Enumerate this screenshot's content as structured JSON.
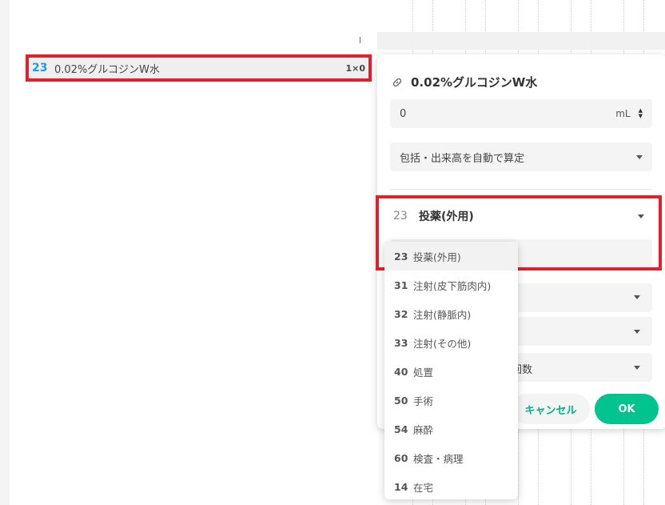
{
  "order_row": {
    "code": "23",
    "name": "0.02%グルコジンW水",
    "qty": "1×0"
  },
  "corner_mark": "l",
  "panel": {
    "title": "0.02%グルコジンW水",
    "amount_value": "0",
    "amount_unit": "mL",
    "calc_mode": "包括・出来高を自動で算定",
    "section_code": "23",
    "section_label": "投薬(外用)",
    "partial_field_text": "回数",
    "cancel_label": "キャンセル",
    "ok_label": "OK"
  },
  "dropdown": {
    "items": [
      {
        "code": "23",
        "label": "投薬(外用)",
        "selected": true
      },
      {
        "code": "31",
        "label": "注射(皮下筋肉内)"
      },
      {
        "code": "32",
        "label": "注射(静脈内)"
      },
      {
        "code": "33",
        "label": "注射(その他)"
      },
      {
        "code": "40",
        "label": "処置"
      },
      {
        "code": "50",
        "label": "手術"
      },
      {
        "code": "54",
        "label": "麻酔"
      },
      {
        "code": "60",
        "label": "検査・病理"
      },
      {
        "code": "14",
        "label": "在宅"
      }
    ]
  },
  "colors": {
    "accent_blue": "#1a9ee6",
    "highlight_red": "#e0202a",
    "ok_green": "#00c38d",
    "cancel_text_green": "#00b386"
  },
  "icons": [
    "pill-icon",
    "chevron-down-icon",
    "spinner-icon"
  ]
}
